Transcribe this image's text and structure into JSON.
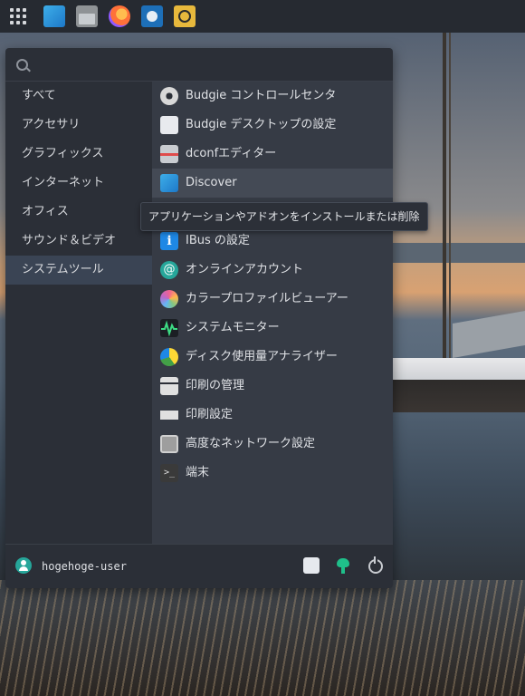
{
  "panel": {
    "launchers": [
      {
        "name": "discover-launcher-icon"
      },
      {
        "name": "files-launcher-icon"
      },
      {
        "name": "firefox-launcher-icon"
      },
      {
        "name": "monitor-launcher-icon"
      },
      {
        "name": "speaker-launcher-icon"
      }
    ]
  },
  "menu": {
    "search": {
      "placeholder": "",
      "value": ""
    },
    "categories": [
      {
        "label": "すべて"
      },
      {
        "label": "アクセサリ"
      },
      {
        "label": "グラフィックス"
      },
      {
        "label": "インターネット"
      },
      {
        "label": "オフィス"
      },
      {
        "label": "サウンド＆ビデオ"
      },
      {
        "label": "システムツール"
      }
    ],
    "active_category": "システムツール",
    "apps": [
      {
        "label": "Budgie コントロールセンタ",
        "icon": "gear-icon",
        "color": "#d8d8d8"
      },
      {
        "label": "Budgie デスクトップの設定",
        "icon": "desktop-settings-icon",
        "color": "#e8eaee"
      },
      {
        "label": "dconfエディター",
        "icon": "dconf-editor-icon",
        "color": "#c9ccd1"
      },
      {
        "label": "Discover",
        "icon": "discover-icon",
        "color": "#3daee9"
      },
      {
        "label": "IBus の設定",
        "icon": "ibus-info-icon",
        "color": "#1e88e5"
      },
      {
        "label": "オンラインアカウント",
        "icon": "online-accounts-icon",
        "color": "#26a69a"
      },
      {
        "label": "カラープロファイルビューアー",
        "icon": "color-profile-icon",
        "color": "#f06292"
      },
      {
        "label": "システムモニター",
        "icon": "system-monitor-icon",
        "color": "#1b1f24"
      },
      {
        "label": "ディスク使用量アナライザー",
        "icon": "disk-usage-icon",
        "color": "#fdd835"
      },
      {
        "label": "印刷の管理",
        "icon": "print-manager-icon",
        "color": "#e0e0e0"
      },
      {
        "label": "印刷設定",
        "icon": "printer-icon",
        "color": "#e0e0e0"
      },
      {
        "label": "高度なネットワーク設定",
        "icon": "network-icon",
        "color": "#9e9e9e"
      },
      {
        "label": "端末",
        "icon": "terminal-icon",
        "color": "#3a3a3a"
      }
    ],
    "tooltip": "アプリケーションやアドオンをインストールまたは削除",
    "footer": {
      "username": "hogehoge-user"
    }
  }
}
